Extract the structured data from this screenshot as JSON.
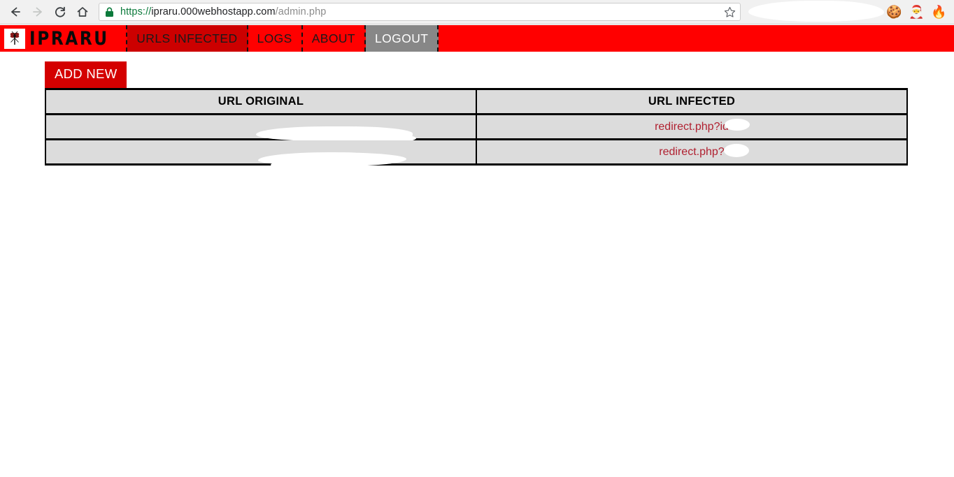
{
  "browser": {
    "back_icon": "back-arrow-icon",
    "forward_icon": "forward-arrow-icon",
    "reload_icon": "reload-icon",
    "home_icon": "home-icon",
    "lock_icon": "lock-icon",
    "star_icon": "star-icon",
    "menu_icon": "kebab-menu-icon",
    "url": {
      "scheme": "https://",
      "host": "ipraru.000webhostapp.com",
      "path": "/admin.php",
      "full": "https://ipraru.000webhostapp.com/admin.php"
    },
    "extensions": [
      {
        "name": "cookie-extension-icon",
        "glyph": "🍪"
      },
      {
        "name": "santa-cookie-extension-icon",
        "glyph": "🎅"
      },
      {
        "name": "fire-extension-icon",
        "glyph": "🔥"
      }
    ]
  },
  "site": {
    "brand": {
      "name": "IPRARU",
      "logo_icon": "mosquito-logo-icon"
    },
    "nav": [
      {
        "label": "URLS INFECTED",
        "state": "active"
      },
      {
        "label": "LOGS",
        "state": "default"
      },
      {
        "label": "ABOUT",
        "state": "default"
      },
      {
        "label": "LOGOUT",
        "state": "logout"
      }
    ],
    "colors": {
      "navbar_red": "#ff0000",
      "nav_active_red": "#cc0000",
      "logout_gray": "#878787",
      "button_red": "#d40000",
      "table_cell_gray": "#dcdcdc",
      "link_blue": "#1414b8",
      "link_crimson": "#b02030"
    }
  },
  "main": {
    "add_new_label": "ADD NEW",
    "table": {
      "headers": [
        "URL ORIGINAL",
        "URL INFECTED"
      ],
      "rows": [
        {
          "url_original": "",
          "url_infected": "redirect.php?id"
        },
        {
          "url_original": "",
          "url_infected": "redirect.php?"
        }
      ]
    }
  }
}
